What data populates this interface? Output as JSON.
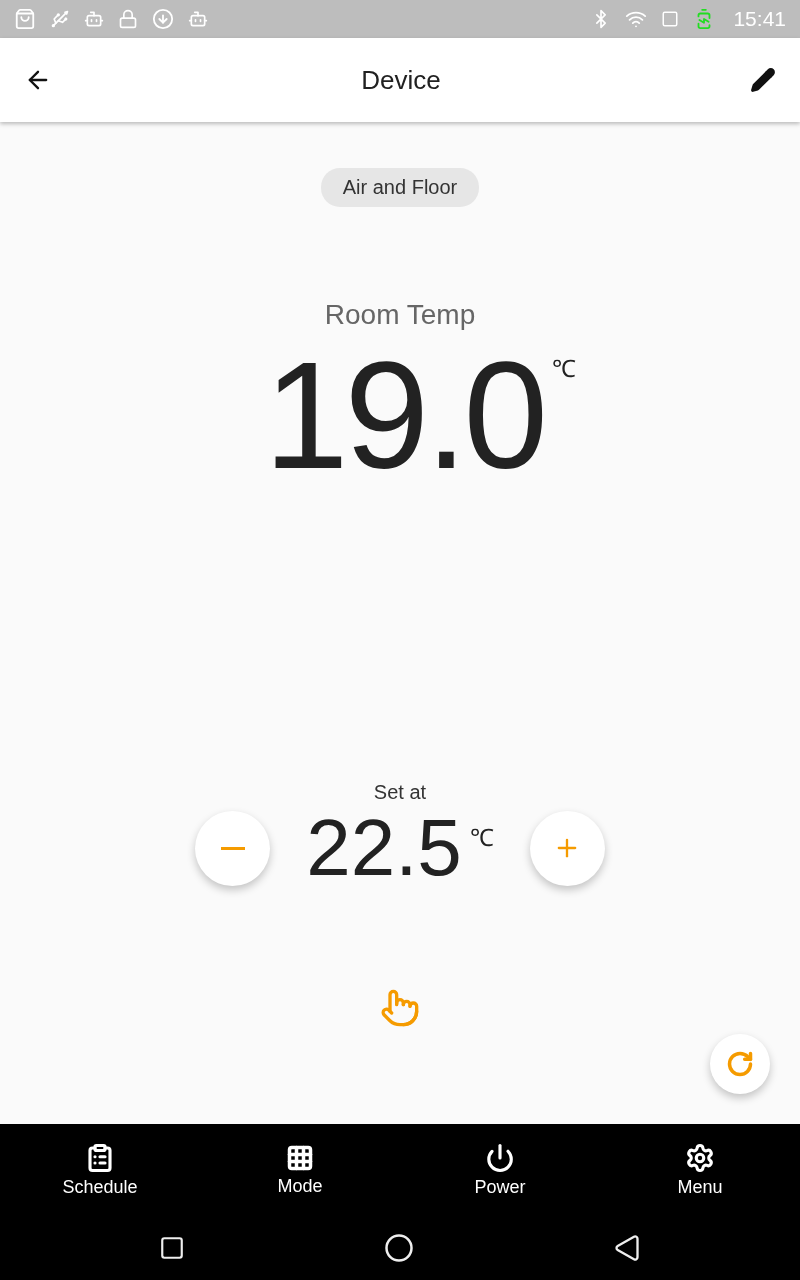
{
  "status_bar": {
    "time": "15:41"
  },
  "app_bar": {
    "title": "Device"
  },
  "mode_chip": "Air and Floor",
  "room": {
    "label": "Room Temp",
    "value": "19.0",
    "unit": "℃"
  },
  "setpoint": {
    "label": "Set at",
    "value": "22.5",
    "unit": "℃"
  },
  "bottom_nav": [
    {
      "kind": "schedule",
      "label": "Schedule"
    },
    {
      "kind": "mode",
      "label": "Mode"
    },
    {
      "kind": "power",
      "label": "Power"
    },
    {
      "kind": "menu",
      "label": "Menu"
    }
  ]
}
